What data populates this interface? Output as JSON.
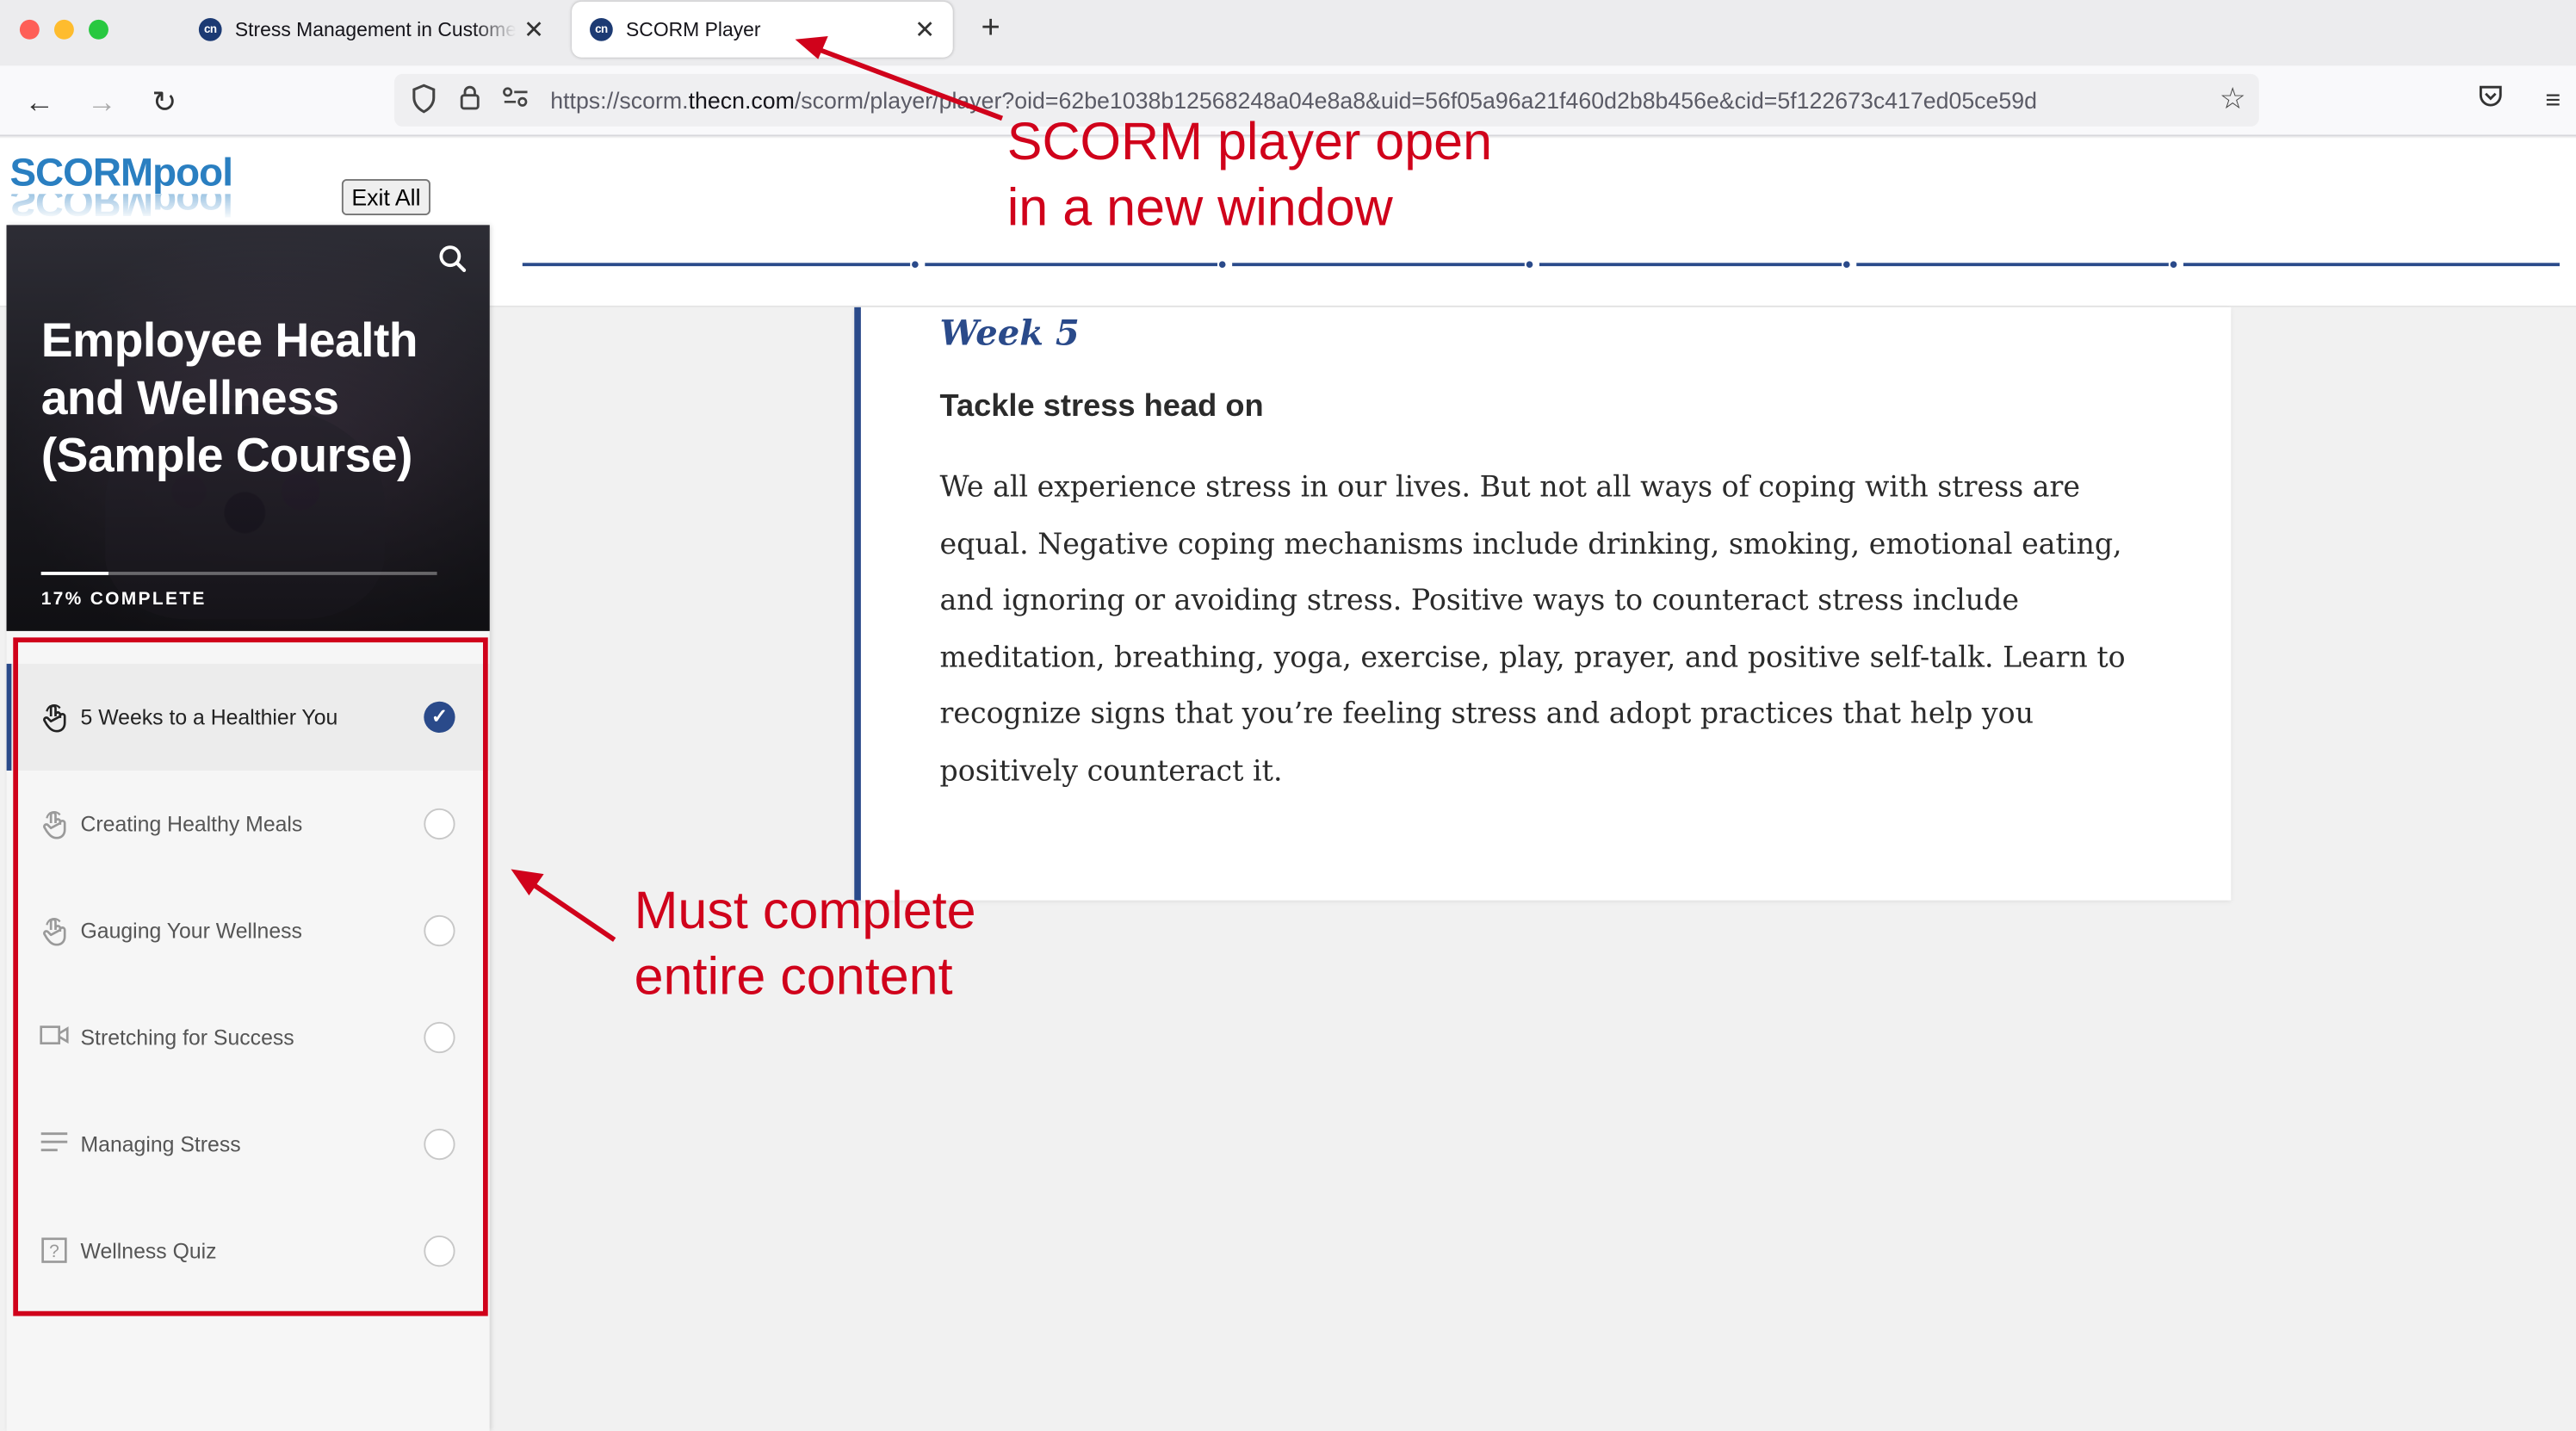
{
  "browser": {
    "tabs": [
      {
        "title": "Stress Management in Customer Service",
        "favicon": "cn",
        "active": false
      },
      {
        "title": "SCORM Player",
        "favicon": "cn",
        "active": true
      }
    ],
    "new_tab_icon": "plus-icon",
    "url_prefix": "https://scorm.",
    "url_domain": "thecn.com",
    "url_path": "/scorm/player/player?oid=62be1038b12568248a04e8a8&uid=56f05a96a21f460d2b8b456e&cid=5f122673c417ed05ce59d"
  },
  "player": {
    "logo": "SCORMpool",
    "exit_label": "Exit All",
    "track_segments": 6
  },
  "sidebar": {
    "course_title": "Employee Health and Wellness (Sample Course)",
    "progress_fraction": 0.17,
    "progress_label": "17% COMPLETE",
    "lessons": [
      {
        "label": "5 Weeks to a Healthier You",
        "icon": "touch-icon",
        "completed": true,
        "active": true
      },
      {
        "label": "Creating Healthy Meals",
        "icon": "touch-icon",
        "completed": false,
        "active": false
      },
      {
        "label": "Gauging Your Wellness",
        "icon": "touch-icon",
        "completed": false,
        "active": false
      },
      {
        "label": "Stretching for Success",
        "icon": "video-icon",
        "completed": false,
        "active": false
      },
      {
        "label": "Managing Stress",
        "icon": "text-lines-icon",
        "completed": false,
        "active": false
      },
      {
        "label": "Wellness Quiz",
        "icon": "quiz-icon",
        "completed": false,
        "active": false
      }
    ]
  },
  "content": {
    "week": "Week 5",
    "heading": "Tackle stress head on",
    "body": "We all experience stress in our lives. But not all ways of coping with stress are equal. Negative coping mechanisms include drinking, smoking, emotional eating, and ignoring or avoiding stress. Positive ways to counteract stress include meditation, breathing, yoga, exercise, play, prayer, and positive self-talk. Learn to recognize signs that you’re feeling stress and adopt practices that help you positively counteract it."
  },
  "annotations": {
    "top_line1": "SCORM player open",
    "top_line2": "in a new window",
    "side_line1": "Must complete",
    "side_line2": "entire content",
    "color": "#d0021b"
  }
}
